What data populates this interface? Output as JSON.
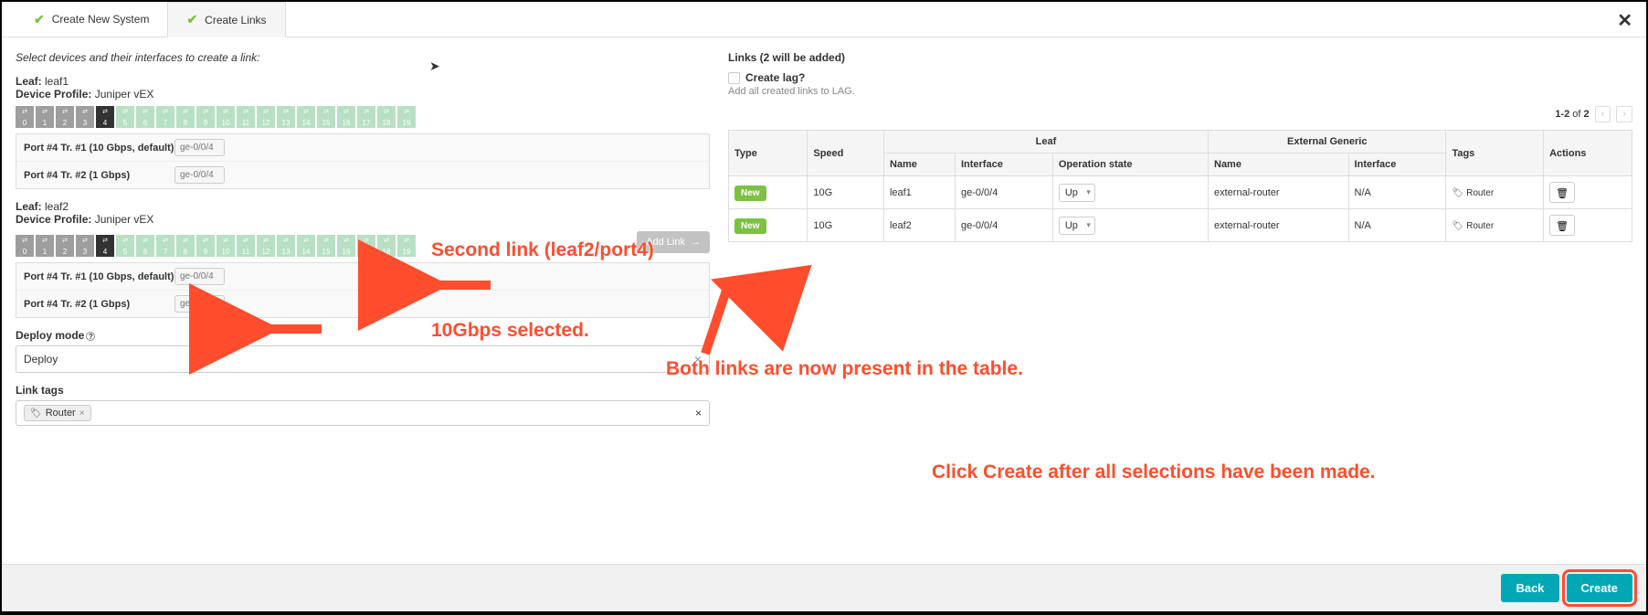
{
  "tabs": {
    "t1": "Create New System",
    "t2": "Create Links"
  },
  "left": {
    "instruction": "Select devices and their interfaces to create a link:",
    "leaf1": {
      "labelKey": "Leaf:",
      "name": "leaf1",
      "profileKey": "Device Profile:",
      "profile": "Juniper vEX"
    },
    "leaf2": {
      "labelKey": "Leaf:",
      "name": "leaf2",
      "profileKey": "Device Profile:",
      "profile": "Juniper vEX"
    },
    "port_row1": "Port #4 Tr. #1 (10 Gbps, default)",
    "port_row2": "Port #4 Tr. #2 (1 Gbps)",
    "port_placeholder": "ge-0/0/4",
    "deploy_label": "Deploy mode",
    "deploy_value": "Deploy",
    "linktags_label": "Link tags",
    "tag_value": "Router",
    "add_link": "Add Link"
  },
  "right": {
    "header": "Links (2 will be added)",
    "lag_label": "Create lag?",
    "lag_hint": "Add all created links to LAG.",
    "page_range": "1-2",
    "page_of": "of",
    "page_total": "2",
    "cols": {
      "type": "Type",
      "speed": "Speed",
      "leaf": "Leaf",
      "ext": "External Generic",
      "name": "Name",
      "iface": "Interface",
      "op": "Operation state",
      "tags": "Tags",
      "actions": "Actions"
    },
    "rows": [
      {
        "badge": "New",
        "speed": "10G",
        "lname": "leaf1",
        "liface": "ge-0/0/4",
        "op": "Up",
        "ename": "external-router",
        "eiface": "N/A",
        "tag": "Router"
      },
      {
        "badge": "New",
        "speed": "10G",
        "lname": "leaf2",
        "liface": "ge-0/0/4",
        "op": "Up",
        "ename": "external-router",
        "eiface": "N/A",
        "tag": "Router"
      }
    ]
  },
  "footer": {
    "back": "Back",
    "create": "Create"
  },
  "annot": {
    "a1": "Second link (leaf2/port4)",
    "a2": "10Gbps selected.",
    "a3": "Both links are now present in the table.",
    "a4": "Click Create after all selections have been made."
  }
}
